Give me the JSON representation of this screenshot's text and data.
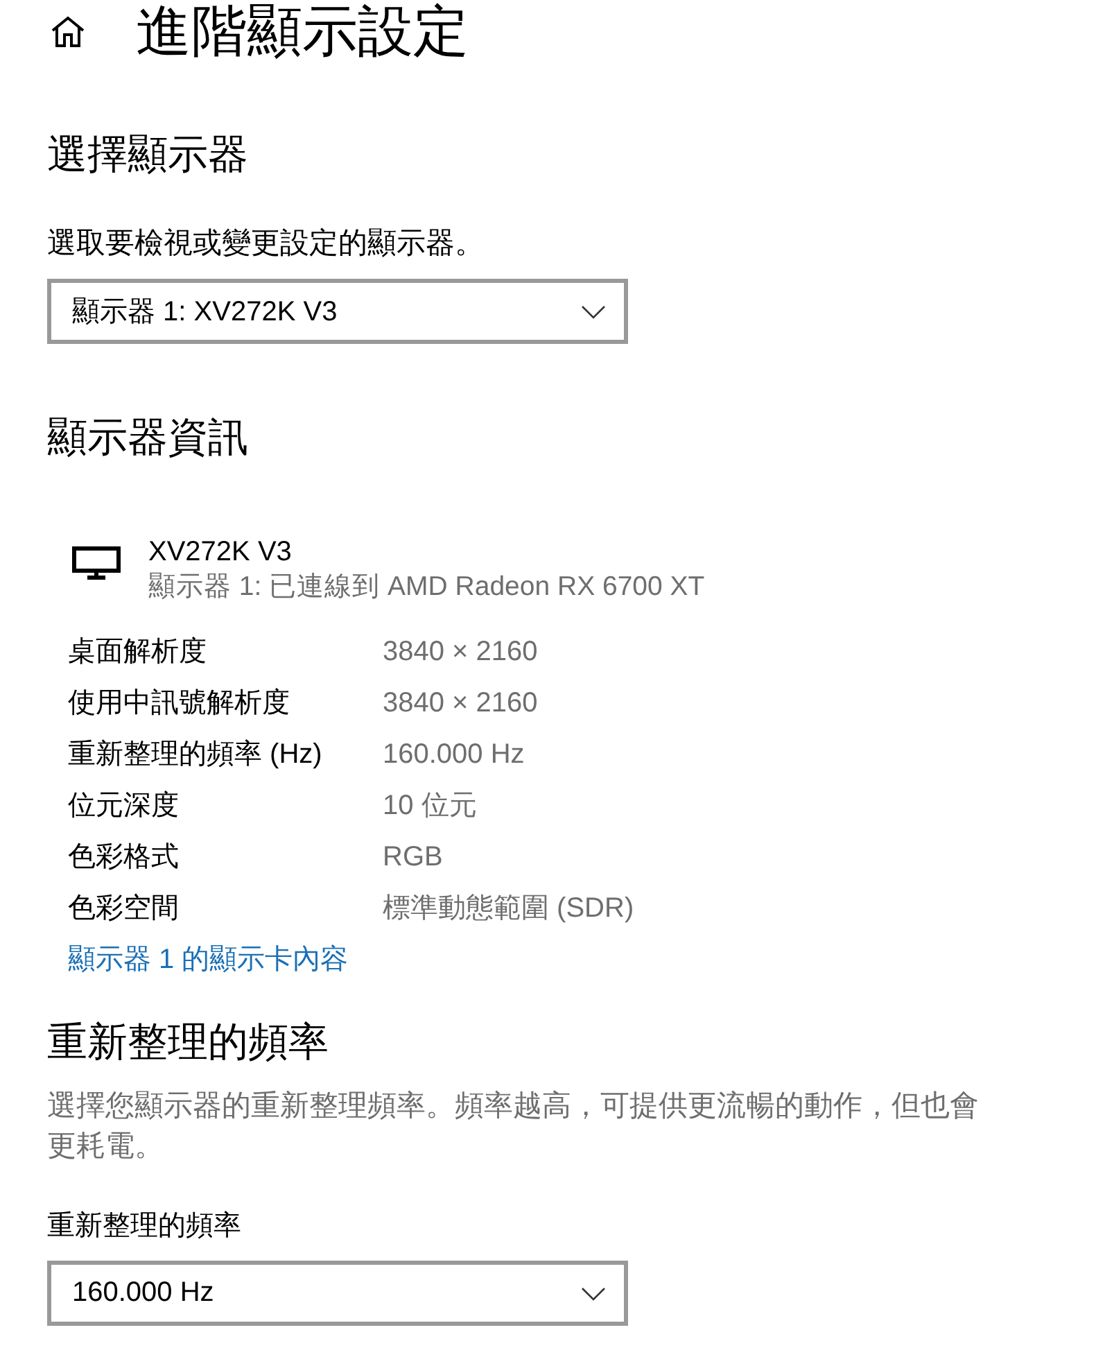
{
  "header": {
    "title": "進階顯示設定"
  },
  "select_display": {
    "heading": "選擇顯示器",
    "description": "選取要檢視或變更設定的顯示器。",
    "dropdown": {
      "value": "顯示器 1: XV272K V3"
    }
  },
  "display_info": {
    "heading": "顯示器資訊",
    "monitor": {
      "name": "XV272K V3",
      "connection": "顯示器 1: 已連線到 AMD Radeon RX 6700 XT"
    },
    "rows": [
      {
        "label": "桌面解析度",
        "value": "3840 × 2160"
      },
      {
        "label": "使用中訊號解析度",
        "value": "3840 × 2160"
      },
      {
        "label": "重新整理的頻率 (Hz)",
        "value": "160.000 Hz"
      },
      {
        "label": "位元深度",
        "value": "10 位元"
      },
      {
        "label": "色彩格式",
        "value": "RGB"
      },
      {
        "label": "色彩空間",
        "value": "標準動態範圍 (SDR)"
      }
    ],
    "link": "顯示器 1 的顯示卡內容"
  },
  "refresh_rate": {
    "heading": "重新整理的頻率",
    "description": "選擇您顯示器的重新整理頻率。頻率越高，可提供更流暢的動作，但也會更耗電。",
    "field_label": "重新整理的頻率",
    "dropdown": {
      "value": "160.000 Hz"
    }
  }
}
